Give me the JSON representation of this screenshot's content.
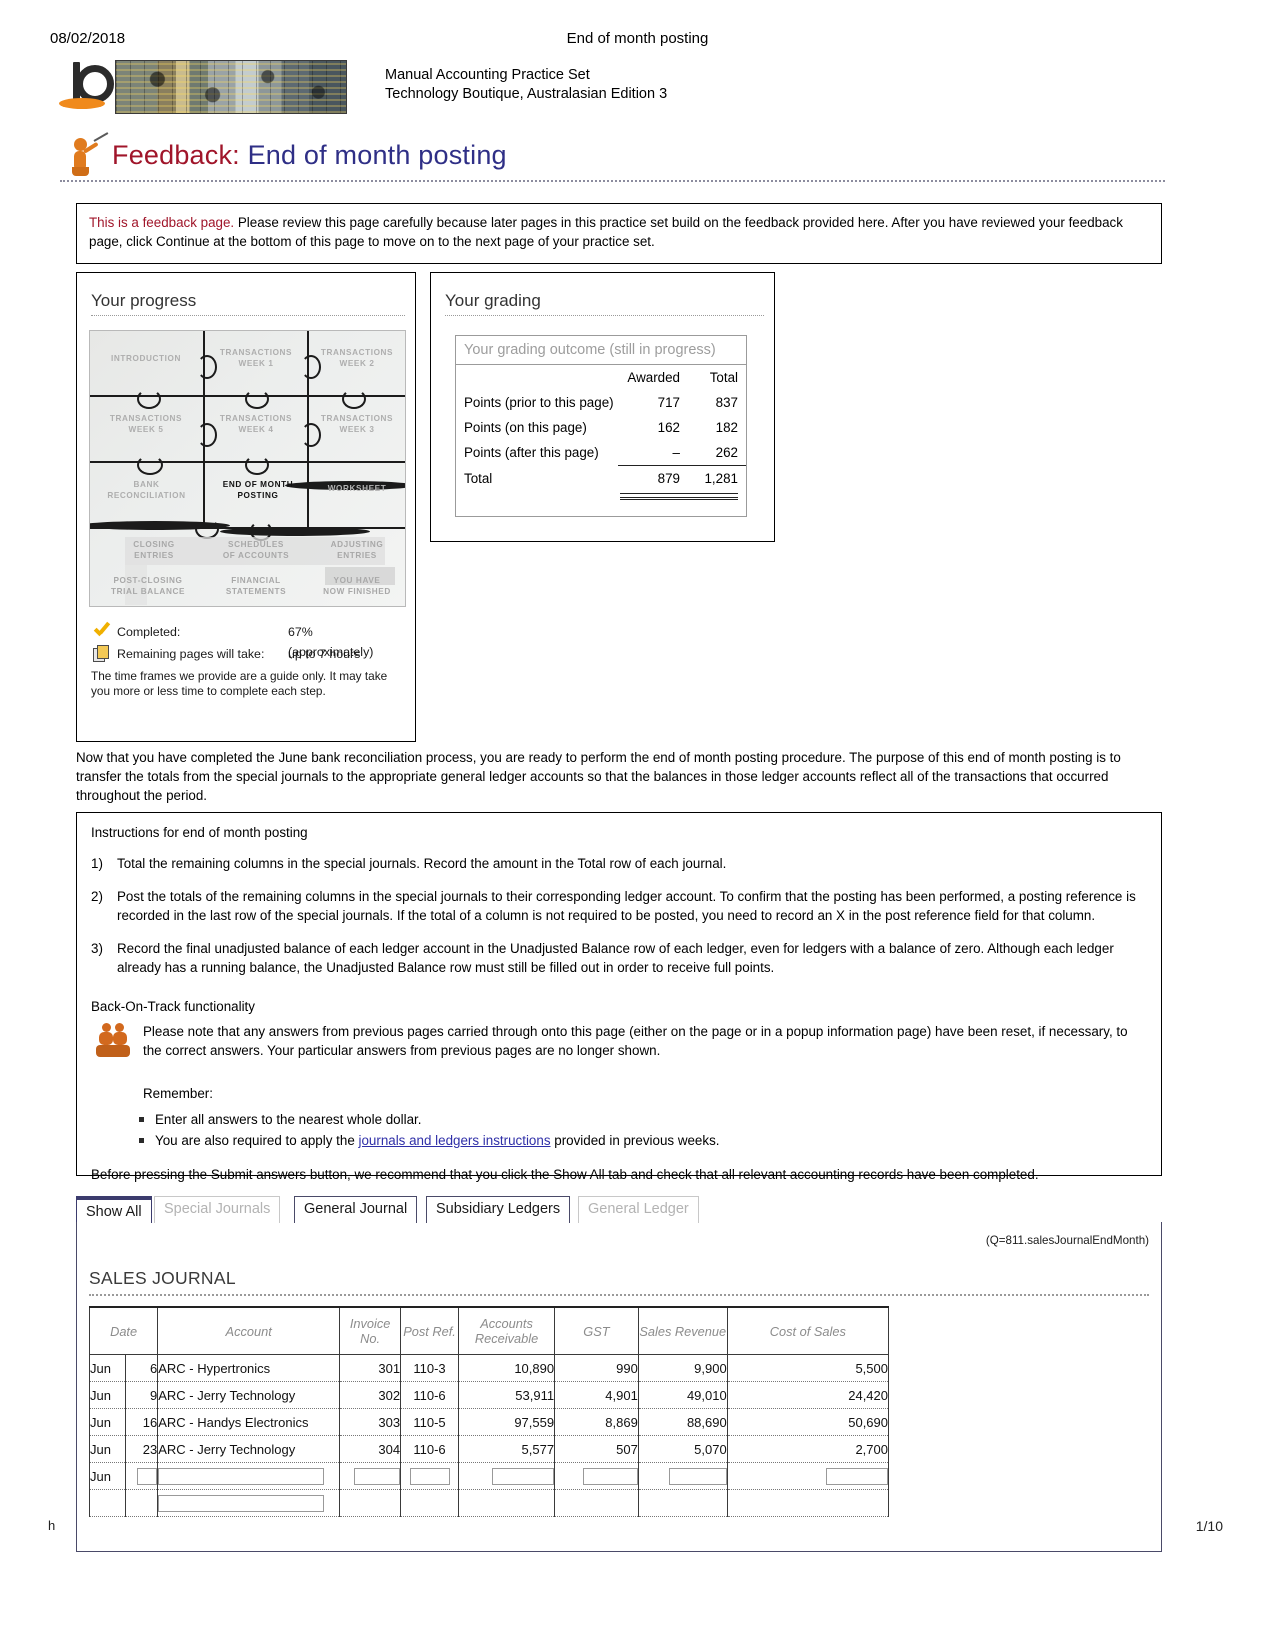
{
  "header": {
    "date": "08/02/2018",
    "doc_title": "End of month posting",
    "brand_line1": "Manual Accounting Practice Set",
    "brand_line2": "Technology Boutique, Australasian Edition 3"
  },
  "page_title": {
    "prefix": "Feedback:",
    "rest": " End of month posting"
  },
  "notice": {
    "lead": "This is a feedback page.",
    "text": " Please review this page carefully because later pages in this practice set build on the feedback provided here. After you have reviewed your feedback page, click Continue at the bottom of this page to move on to the next page of your practice set."
  },
  "progress": {
    "heading": "Your progress",
    "puzzle_cells": [
      "INTRODUCTION",
      "TRANSACTIONS WEEK 1",
      "TRANSACTIONS WEEK 2",
      "TRANSACTIONS WEEK 5",
      "TRANSACTIONS WEEK 4",
      "TRANSACTIONS WEEK 3",
      "BANK RECONCILIATION",
      "END OF MONTH POSTING",
      "WORKSHEET",
      "CLOSING ENTRIES",
      "SCHEDULES OF ACCOUNTS",
      "ADJUSTING ENTRIES",
      "POST-CLOSING TRIAL BALANCE",
      "FINANCIAL STATEMENTS",
      "YOU HAVE NOW FINISHED"
    ],
    "current_cell": "END OF MONTH POSTING",
    "completed_label": "Completed:",
    "completed_value": "67% (approximately)",
    "remaining_label": "Remaining pages will take:",
    "remaining_value": "up to 7 hours",
    "note": "The time frames we provide are a guide only. It may take you more or less time to complete each step."
  },
  "grading": {
    "heading": "Your grading",
    "caption": "Your grading outcome (still in progress)",
    "col_awarded": "Awarded",
    "col_total": "Total",
    "rows": [
      {
        "label": "Points (prior to this page)",
        "awarded": "717",
        "total": "837"
      },
      {
        "label": "Points (on this page)",
        "awarded": "162",
        "total": "182"
      },
      {
        "label": "Points (after this page)",
        "awarded": "–",
        "total": "262"
      },
      {
        "label": "Total",
        "awarded": "879",
        "total": "1,281"
      }
    ]
  },
  "body_paragraph": "Now that you have completed the June bank reconciliation process, you are ready to perform the end of month posting procedure. The purpose of this end of month posting is to transfer the totals from the special journals to the appropriate general ledger accounts so that the balances in those ledger accounts reflect all of the transactions that occurred throughout the period.",
  "instructions": {
    "heading": "Instructions for end of month posting",
    "items": [
      {
        "n": "1)",
        "text": "Total the remaining columns in the special journals. Record the amount in the Total row of each journal."
      },
      {
        "n": "2)",
        "text": "Post the totals of the remaining columns in the special journals to their corresponding ledger account. To confirm that the posting has been performed, a posting reference is recorded in the last row of the special journals. If the total of a column is not required to be posted, you need to record an X in the post reference field for that column."
      },
      {
        "n": "3)",
        "text": "Record the final unadjusted balance of each ledger account in the Unadjusted Balance row of each ledger, even for ledgers with a balance of zero. Although each ledger already has a running balance, the Unadjusted Balance row must still be filled out in order to receive full points."
      }
    ],
    "back_on_track_heading": "Back-On-Track functionality",
    "back_on_track_text": "Please note that any answers from previous pages carried through onto this page (either on the page or in a popup information page) have been reset, if necessary, to the correct answers. Your particular answers from previous pages are no longer shown.",
    "remember_label": "Remember:",
    "bullets": [
      {
        "pre": "Enter all answers to the nearest whole dollar.",
        "link": "",
        "post": ""
      },
      {
        "pre": "You are also required to apply the ",
        "link": "journals and ledgers instructions",
        "post": " provided in previous weeks."
      }
    ],
    "before_submit": "Before pressing the Submit answers button, we recommend that you click the Show All tab and check that all relevant accounting records have been completed."
  },
  "tabs": [
    {
      "label": "Show All",
      "state": "active"
    },
    {
      "label": "Special Journals",
      "state": "dim"
    },
    {
      "label": "General Journal",
      "state": "norm"
    },
    {
      "label": "Subsidiary Ledgers",
      "state": "norm"
    },
    {
      "label": "General Ledger",
      "state": "dim"
    }
  ],
  "journal": {
    "qcode": "(Q=811.salesJournalEndMonth)",
    "title": "SALES JOURNAL",
    "columns": [
      "Date",
      "Account",
      "Invoice No.",
      "Post Ref.",
      "Accounts Receivable",
      "GST",
      "Sales Revenue",
      "Cost of Sales"
    ],
    "rows": [
      {
        "month": "Jun",
        "day": "6",
        "account": "ARC - Hypertronics",
        "invoice": "301",
        "post_ref": "110-3",
        "ar": "10,890",
        "gst": "990",
        "sales": "9,900",
        "cos": "5,500"
      },
      {
        "month": "Jun",
        "day": "9",
        "account": "ARC - Jerry Technology",
        "invoice": "302",
        "post_ref": "110-6",
        "ar": "53,911",
        "gst": "4,901",
        "sales": "49,010",
        "cos": "24,420"
      },
      {
        "month": "Jun",
        "day": "16",
        "account": "ARC - Handys Electronics",
        "invoice": "303",
        "post_ref": "110-5",
        "ar": "97,559",
        "gst": "8,869",
        "sales": "88,690",
        "cos": "50,690"
      },
      {
        "month": "Jun",
        "day": "23",
        "account": "ARC - Jerry Technology",
        "invoice": "304",
        "post_ref": "110-6",
        "ar": "5,577",
        "gst": "507",
        "sales": "5,070",
        "cos": "2,700"
      }
    ],
    "blank_row": {
      "month": "Jun"
    }
  },
  "footer": {
    "left": "h",
    "right": "1/10"
  }
}
